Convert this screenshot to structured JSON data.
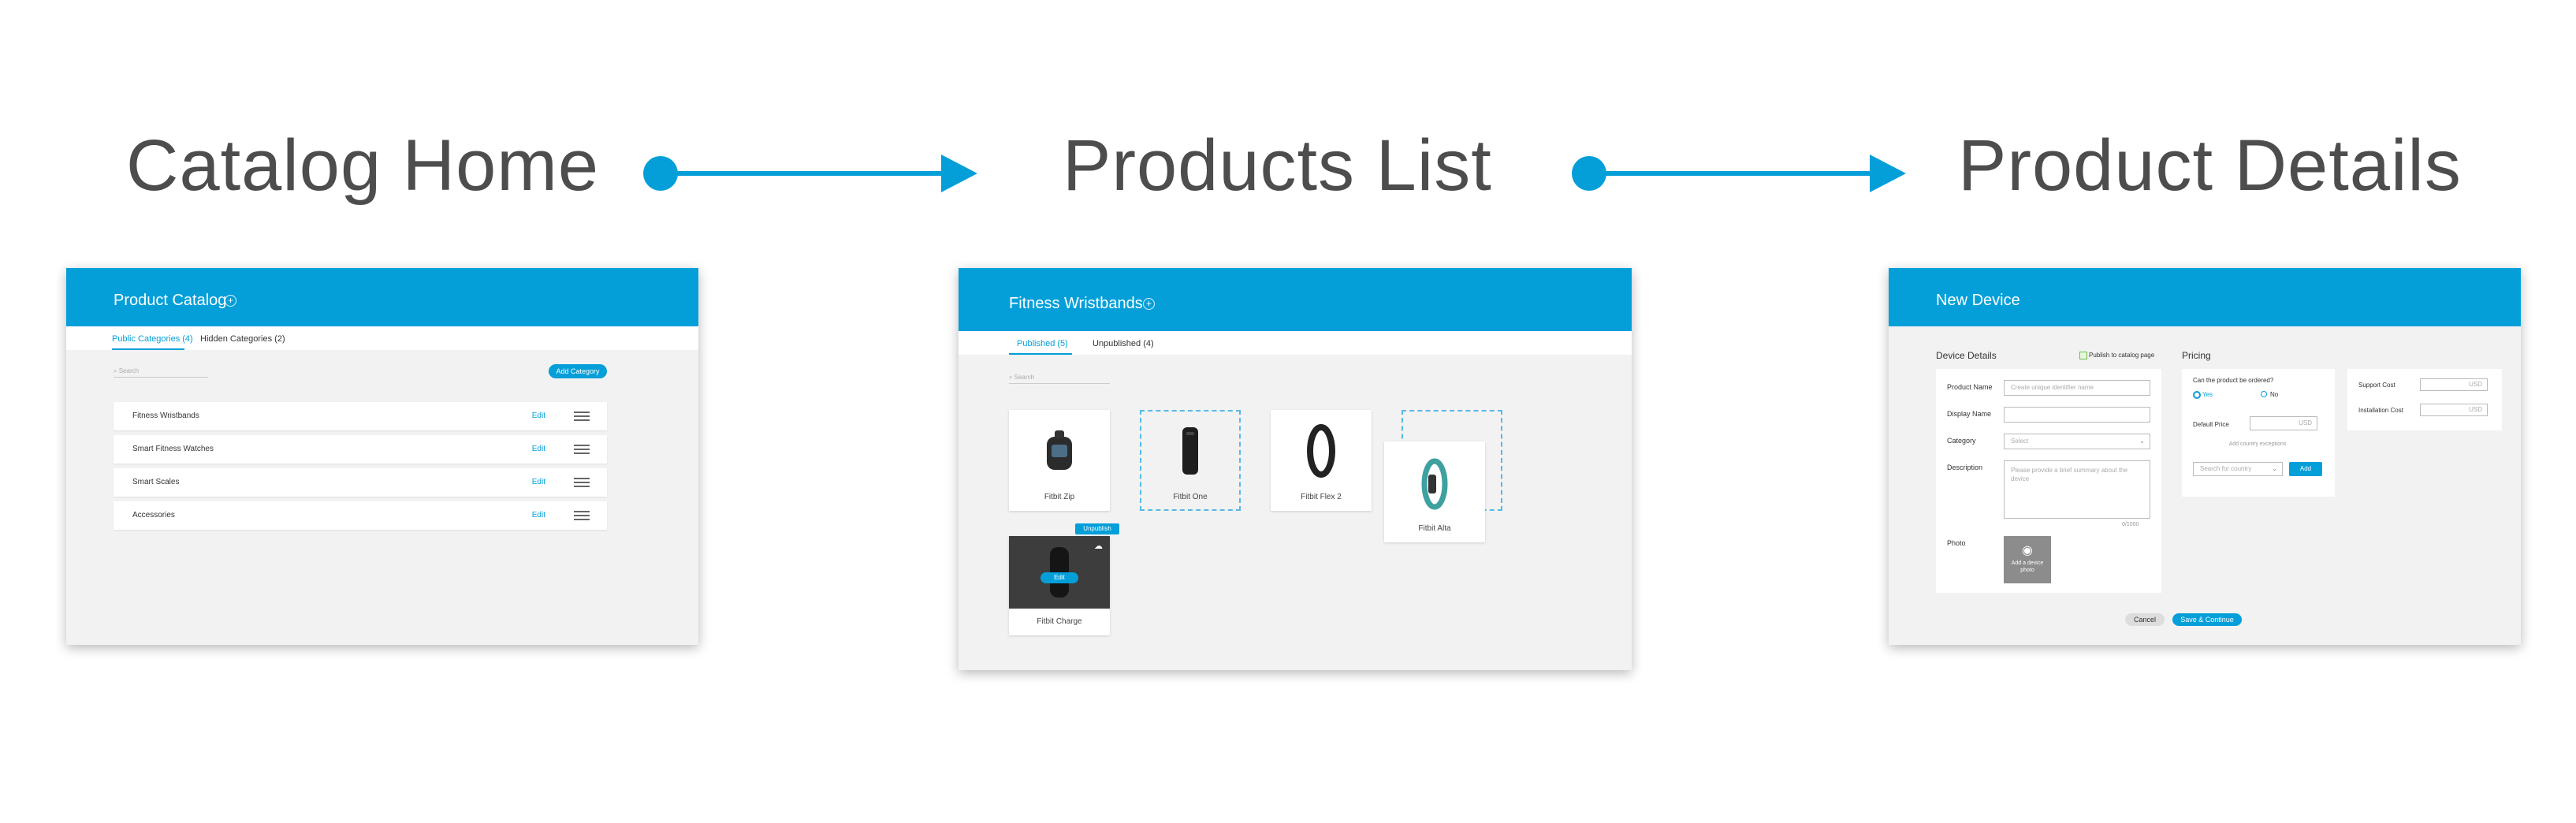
{
  "steps": {
    "catalog_home": "Catalog Home",
    "products_list": "Products List",
    "product_details": "Product Details"
  },
  "colors": {
    "accent": "#049fd9",
    "panel_bg": "#f2f2f2",
    "title_text": "#4d4d4d"
  },
  "catalog": {
    "title": "Product Catalog",
    "tabs": [
      "Public Categories (4)",
      "Hidden Categories (2)"
    ],
    "search_placeholder": "Search",
    "add_button": "Add Category",
    "edit_label": "Edit",
    "categories": [
      "Fitness Wristbands",
      "Smart Fitness Watches",
      "Smart Scales",
      "Accessories"
    ]
  },
  "products": {
    "title": "Fitness Wristbands",
    "tabs": [
      "Published (5)",
      "Unpublished (4)"
    ],
    "search_placeholder": "Search",
    "items": [
      "Fitbit Zip",
      "Fitbit One",
      "Fitbit Flex 2",
      "Fitbit Alta",
      "Fitbit Charge"
    ],
    "unpublish_label": "Unpublish",
    "edit_label": "Edit"
  },
  "details": {
    "title": "New Device",
    "device_section": "Device Details",
    "publish_label": "Publish to catalog page",
    "fields": {
      "product_name": "Product Name",
      "product_name_placeholder": "Create unique identifier name",
      "display_name": "Display Name",
      "category": "Category",
      "category_placeholder": "Select",
      "description": "Description",
      "description_placeholder": "Please provide a brief summary about the device",
      "char_count": "0/1000",
      "photo": "Photo",
      "photo_hint": "Add a device photo"
    },
    "pricing": {
      "title": "Pricing",
      "question": "Can the product be ordered?",
      "yes": "Yes",
      "no": "No",
      "default_price": "Default Price",
      "currency": "USD",
      "add_exceptions": "Add country exceptions",
      "search_country": "Search for country",
      "add": "Add",
      "support_cost": "Support Cost",
      "installation_cost": "Installation Cost"
    },
    "cancel": "Cancel",
    "save": "Save & Continue"
  }
}
